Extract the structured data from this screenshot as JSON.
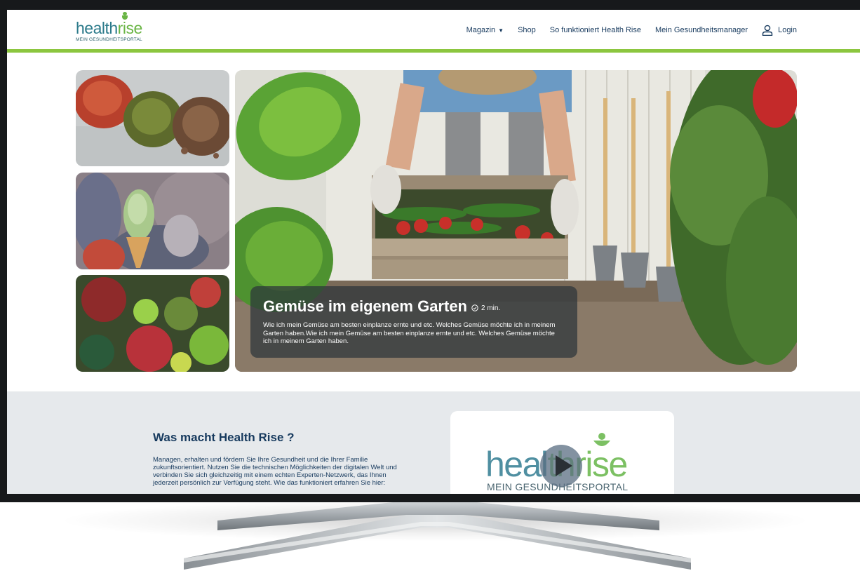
{
  "logo": {
    "word_a": "health",
    "word_b": "rise",
    "subtitle": "MEIN GESUNDHEITSPORTAL"
  },
  "nav": {
    "magazin": "Magazin",
    "shop": "Shop",
    "how": "So funktioniert Health Rise",
    "manager": "Mein Gesundheitsmanager",
    "login": "Login"
  },
  "hero": {
    "title": "Gemüse im eigenem Garten",
    "read_time": "2 min.",
    "text": "Wie ich mein Gemüse am besten einplanze ernte und etc. Welches Gemüse möchte ich in meinem Garten haben.Wie ich mein Gemüse am besten einplanze ernte und etc. Welches Gemüse möchte ich in meinem Garten haben."
  },
  "about": {
    "title": "Was macht Health Rise ?",
    "text": "Managen, erhalten und fördern Sie Ihre Gesundheit und die Ihrer Familie zukunftsorientiert. Nutzen Sie die technischen Möglichkeiten der digitalen Welt und verbinden Sie sich gleichzeitig mit einem echten Experten-Netzwerk, das Ihnen jederzeit persönlich zur Verfügung steht. Wie das funktioniert erfahren Sie hier:"
  },
  "video": {
    "logo_a": "heal",
    "logo_b": "thrise",
    "subtitle": "MEIN GESUNDHEITSPORTAL"
  },
  "colors": {
    "brand_green": "#8cc63f",
    "brand_teal": "#2b7a8a",
    "navy": "#173a5e"
  }
}
